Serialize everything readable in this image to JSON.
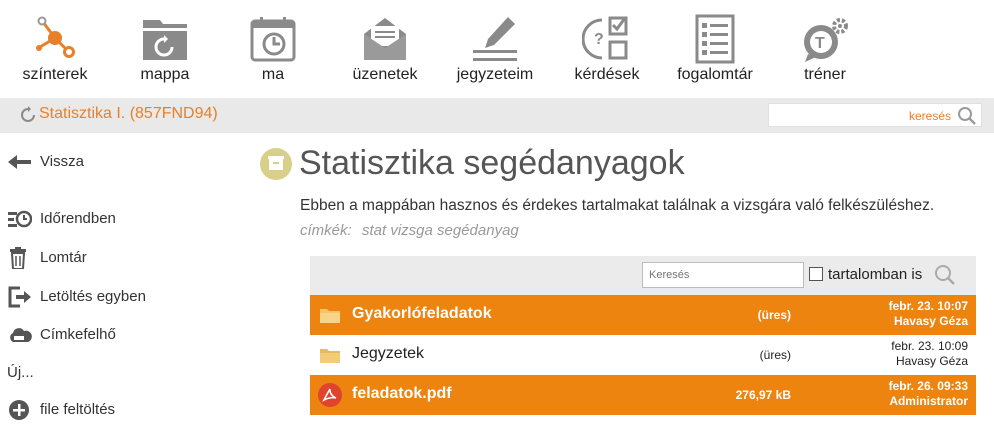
{
  "topnav": {
    "items": [
      {
        "label": "színterek",
        "icon": "network-nodes-icon"
      },
      {
        "label": "mappa",
        "icon": "folder-icon"
      },
      {
        "label": "ma",
        "icon": "calendar-clock-icon"
      },
      {
        "label": "üzenetek",
        "icon": "envelope-icon"
      },
      {
        "label": "jegyzeteim",
        "icon": "pencil-notes-icon"
      },
      {
        "label": "kérdések",
        "icon": "question-checklist-icon"
      },
      {
        "label": "fogalomtár",
        "icon": "glossary-list-icon"
      },
      {
        "label": "tréner",
        "icon": "trainer-gear-icon"
      }
    ]
  },
  "course": {
    "title": "Statisztika I. (857FND94)"
  },
  "search": {
    "label": "keresés"
  },
  "sidebar": {
    "back": "Vissza",
    "items": [
      {
        "label": "Időrendben",
        "icon": "timeline-icon"
      },
      {
        "label": "Lomtár",
        "icon": "trash-icon"
      },
      {
        "label": "Letöltés egyben",
        "icon": "download-export-icon"
      },
      {
        "label": "Címkefelhő",
        "icon": "tag-cloud-icon"
      }
    ],
    "new_label": "Új...",
    "upload": "file feltöltés"
  },
  "main": {
    "title": "Statisztika segédanyagok",
    "description": "Ebben a mappában hasznos és érdekes tartalmakat találnak a vizsgára való felkészüléshez.",
    "tags_label": "címkék:",
    "tags_value": "stat vizsga segédanyag"
  },
  "list": {
    "search_placeholder": "Keresés",
    "in_content_label": "tartalomban is",
    "rows": [
      {
        "name": "Gyakorlófeladatok",
        "size": "(üres)",
        "date": "febr. 23. 10:07",
        "author": "Havasy Géza",
        "type": "folder",
        "highlight": true
      },
      {
        "name": "Jegyzetek",
        "size": "(üres)",
        "date": "febr. 23. 10:09",
        "author": "Havasy Géza",
        "type": "folder",
        "highlight": false
      },
      {
        "name": "feladatok.pdf",
        "size": "276,97 kB",
        "date": "febr. 26. 09:33",
        "author": "Administrator",
        "type": "pdf",
        "highlight": true
      }
    ]
  },
  "colors": {
    "accent": "#e8802a",
    "row_highlight": "#ec840f",
    "icon_gray": "#8a8a8a"
  }
}
